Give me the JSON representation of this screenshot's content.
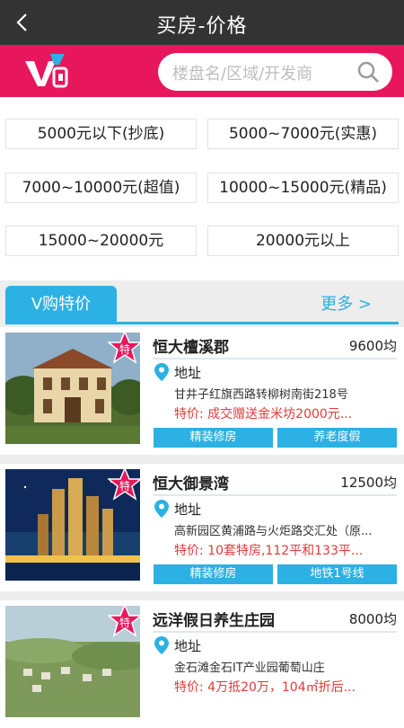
{
  "header": {
    "title": "买房-价格",
    "back_glyph": "<"
  },
  "search": {
    "placeholder": "楼盘名/区域/开发商"
  },
  "price_ranges": [
    "5000元以下(抄底)",
    "5000~7000元(实惠)",
    "7000~10000元(超值)",
    "10000~15000元(精品)",
    "15000~20000元",
    "20000元以上"
  ],
  "section": {
    "tab_label": "V购特价",
    "more_label": "更多 >"
  },
  "listings": [
    {
      "badge": "特",
      "name": "恒大檀溪郡",
      "price": "9600均",
      "addr_label": "地址",
      "address": "甘井子红旗西路转柳树南街218号",
      "deal": "特价: 成交赠送金米坊2000元...",
      "tags": [
        "精装修房",
        "养老度假"
      ]
    },
    {
      "badge": "特",
      "name": "恒大御景湾",
      "price": "12500均",
      "addr_label": "地址",
      "address": "高新园区黄浦路与火炬路交汇处（原...",
      "deal": "特价: 10套特房,112平和133平...",
      "tags": [
        "精装修房",
        "地铁1号线"
      ]
    },
    {
      "badge": "特",
      "name": "远洋假日养生庄园",
      "price": "8000均",
      "addr_label": "地址",
      "address": "金石滩金石IT产业园葡萄山庄",
      "deal": "特价: 4万抵20万，104㎡折后...",
      "tags": []
    }
  ],
  "colors": {
    "brand": "#e8175d",
    "accent": "#2bb1e3",
    "deal": "#e33a3a",
    "topbar": "#333333"
  }
}
